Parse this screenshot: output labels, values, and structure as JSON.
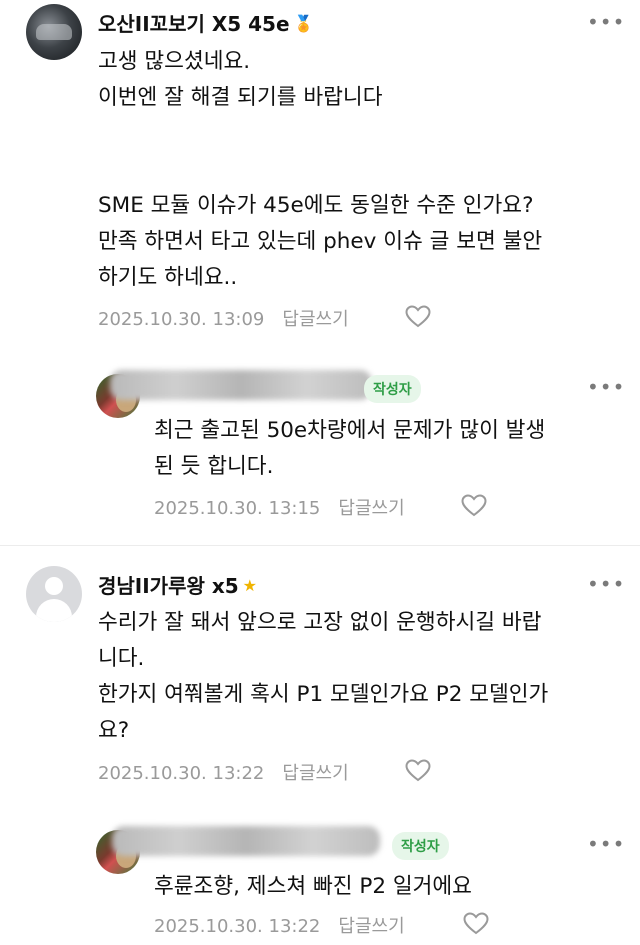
{
  "comments": [
    {
      "nickname": "오산II꼬보기 X5 45e",
      "badge": "medal-icon",
      "lines": [
        "고생 많으셨네요.",
        "이번엔 잘 해결 되기를 바랍니다",
        "",
        "",
        "SME 모듈 이슈가 45e에도 동일한 수준 인가요?",
        "만족 하면서 타고 있는데 phev 이슈 글 보면 불안",
        "하기도 하네요.."
      ],
      "date": "2025.10.30. 13:09",
      "reply_label": "답글쓰기"
    },
    {
      "author_tag": "작성자",
      "lines": [
        "최근 출고된 50e차량에서 문제가 많이 발생",
        "된 듯 합니다."
      ],
      "date": "2025.10.30. 13:15",
      "reply_label": "답글쓰기"
    },
    {
      "nickname": "경남II가루왕 x5",
      "badge": "star-icon",
      "lines": [
        "수리가 잘 돼서 앞으로 고장 없이 운행하시길 바랍",
        "니다.",
        "한가지 여쭤볼게 혹시 P1 모델인가요 P2 모델인가",
        "요?"
      ],
      "date": "2025.10.30. 13:22",
      "reply_label": "답글쓰기"
    },
    {
      "author_tag": "작성자",
      "lines": [
        "후륜조향, 제스쳐 빠진 P2 일거에요"
      ],
      "date": "2025.10.30. 13:22",
      "reply_label": "답글쓰기"
    }
  ],
  "more_label": "•••"
}
